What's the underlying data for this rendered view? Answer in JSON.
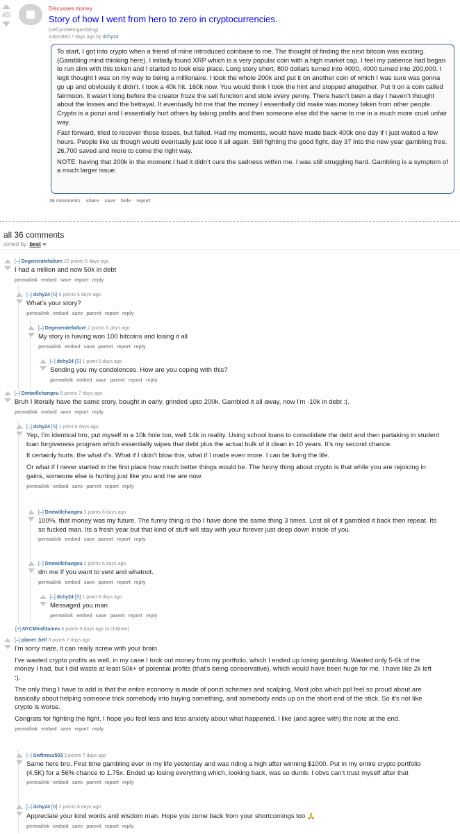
{
  "post": {
    "score": "45",
    "flair": "Discusses money",
    "title": "Story of how I went from hero to zero in cryptocurrencies.",
    "domain": "(self.problemgambling)",
    "submitted_prefix": "submitted 7 days ago by",
    "author": "dchy24",
    "selftext": [
      "To start, I got into crypto when a friend of mine introduced coinbase to me. The thought of finding the next bitcoin was exciting. (Gambling mind thinking here). I initially found XRP which is a very popular coin with a high market cap. I feel my patience had began to run slim with this token and I started to look else place. Long story short, 800 dollars turned into 4000, 4000 turned into 200,000. I legit thought I was on my way to being a millionaire. I took the whole 200k and put it on another coin of which I was sure was gonna go up and obviously it didn’t. I took a 40k hit. 160k now. You would think I took the hint and stopped altogether. Put it on a coin called fairmoon. It wasn’t long before the creator froze the sell function and stole every penny. There hasn’t been a day I haven’t thought about the losses and the betrayal. It eventually hit me that the money I essentially did make was money taken from other people. Crypto is a ponzi and I essentially hurt others by taking profits and then someone else did the same to me in a much more cruel unfair way.",
      "Fast forward, tried to recover those losses, but failed. Had my moments, would have made back 400k one day if I just waited a few hours. People like us though would eventually just lose it all again. Still fighting the good fight, day 37 into the new year gambling free. 26,700 saved and more to come the right way.",
      "NOTE: having that 200k in the moment I had it didn’t cure the sadness within me. I was still struggling hard. Gambling is a symptom of a much larger issue."
    ],
    "links": [
      "36 comments",
      "share",
      "save",
      "hide",
      "report"
    ]
  },
  "comments_header": {
    "title": "all 36 comments",
    "sorted_by_label": "sorted by:",
    "sort_value": "best"
  },
  "comments": [
    {
      "expand": "[–]",
      "author": "Degeneratefailure",
      "op": "",
      "meta": "10 points 6 days ago",
      "text": [
        "I had a million and now 50k in debt"
      ],
      "links": [
        "permalink",
        "embed",
        "save",
        "report",
        "reply"
      ]
    },
    {
      "expand": "[–]",
      "author": "dchy24",
      "op": "[S]",
      "meta": "6 points 6 days ago",
      "text": [
        "What’s your story?"
      ],
      "links": [
        "permalink",
        "embed",
        "save",
        "parent",
        "report",
        "reply"
      ]
    },
    {
      "expand": "[–]",
      "author": "Degeneratefailure",
      "op": "",
      "meta": "2 points 5 days ago",
      "text": [
        "My story is having won 100 bitcoins and losing it all"
      ],
      "links": [
        "permalink",
        "embed",
        "save",
        "parent",
        "report",
        "reply"
      ]
    },
    {
      "expand": "[–]",
      "author": "dchy24",
      "op": "[S]",
      "meta": "1 point 5 days ago",
      "text": [
        "Sending you my condolences. How are you coping with this?"
      ],
      "links": [
        "permalink",
        "embed",
        "save",
        "parent",
        "report",
        "reply"
      ]
    },
    {
      "expand": "[–]",
      "author": "Dmtwillchangeu",
      "op": "",
      "meta": "6 points 7 days ago",
      "text": [
        "Bruh I literally have the same story. bought in early, grinded upto 200k. Gambled it all away, now I'm -10k in debt :(."
      ],
      "links": [
        "permalink",
        "embed",
        "save",
        "report",
        "reply"
      ]
    },
    {
      "expand": "[–]",
      "author": "dchy24",
      "op": "[S]",
      "meta": "1 point 6 days ago",
      "text": [
        "Yep, I’m identical bro, put myself in a 10k hole too, well 14k in reality. Using school loans to consolidate the debt and then partaking in student loan forgiveness program which essentially wipes that debt plus the actual bulk of it clean in 10 years. It’s my second chance.",
        "It certainly hurts, the what if’s. What if I didn’t blow this, what if I made even more. I can be living the life.",
        "Or what if I never started in the first place how much better things would be. The funny thing about crypto is that while you are rejoicing in gains, someone else is hurting just like you and me are now."
      ],
      "links": [
        "permalink",
        "embed",
        "save",
        "parent",
        "report",
        "reply"
      ]
    },
    {
      "expand": "[–]",
      "author": "Dmtwillchangeu",
      "op": "",
      "meta": "3 points 6 days ago",
      "text": [
        "100%. that money was my future. The funny thing is tho I have done the same thing 3 times. Lost all of it gambled it back then repeat. Its so fucked man. Its a fresh year but that kind of stuff will stay with your forever just deep down inside of you."
      ],
      "links": [
        "permalink",
        "embed",
        "save",
        "parent",
        "report",
        "reply"
      ]
    },
    {
      "expand": "[–]",
      "author": "Dmtwillchangeu",
      "op": "",
      "meta": "2 points 6 days ago",
      "text": [
        "dm me If you want to vent and whatnot."
      ],
      "links": [
        "permalink",
        "embed",
        "save",
        "parent",
        "report",
        "reply"
      ]
    },
    {
      "expand": "[–]",
      "author": "dchy24",
      "op": "[S]",
      "meta": "1 point 6 days ago",
      "text": [
        "Messaged you man"
      ],
      "links": [
        "permalink",
        "embed",
        "save",
        "parent",
        "report",
        "reply"
      ]
    },
    {
      "expand": "[–]",
      "author": "planet_hell",
      "op": "",
      "meta": "3 points 7 days ago",
      "text": [
        "I'm sorry mate, it can really screw with your brain.",
        "I've wasted crypto profits as well, in my case I took out money from my portfolio, which I ended up losing gambling. Wasted only 5-6k of the money I had, but I did waste at least 50k+ of potential profits (that's being conservative), which would have been huge for me. I have like 2k left :).",
        "The only thing I have to add is that the entire economy is made of ponzi schemes and scalping. Most jobs which ppl feel so proud about are basically about helping someone trick somebody into buying something, and somebody ends up on the short end of the stick. So it's not like crypto is worse.",
        "Congrats for fighting the fight. I hope you feel less and less anxiety about what happened. I like (and agree with) the note at the end."
      ],
      "links": [
        "permalink",
        "embed",
        "save",
        "report",
        "reply"
      ]
    },
    {
      "expand": "[–]",
      "author": "Swftness503",
      "op": "",
      "meta": "3 points 7 days ago",
      "text": [
        "Same here bro. First time gambling ever in my life yesterday and was riding a high after winning $1000. Put in my entire crypto portfolio (4.5K) for a 56% chance to 1.75x. Ended up losing everything which, looking back, was so dumb. I obvs can’t trust myself after that"
      ],
      "links": [
        "permalink",
        "embed",
        "save",
        "parent",
        "report",
        "reply"
      ]
    },
    {
      "expand": "[–]",
      "author": "dchy24",
      "op": "[S]",
      "meta": "2 points 6 days ago",
      "text": [
        "Appreciate your kind words and wisdom man. Hope you come back from your shortcomings too"
      ],
      "links": [
        "permalink",
        "embed",
        "save",
        "parent",
        "report",
        "reply"
      ]
    }
  ],
  "collapsed": {
    "expand": "[+]",
    "author": "NYCMindGames",
    "meta": "6 points 6 days ago (4 children)"
  }
}
